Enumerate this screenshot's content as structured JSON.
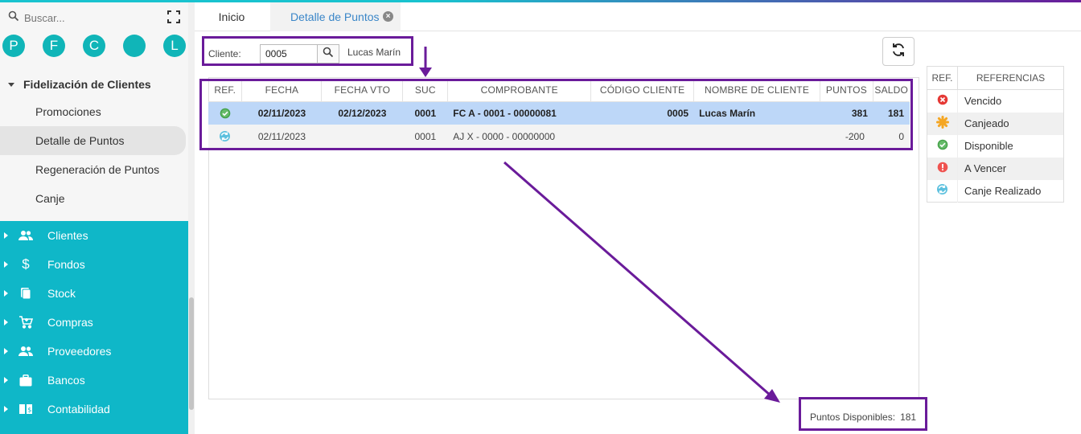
{
  "sidebar": {
    "search_placeholder": "Buscar...",
    "avatars": [
      "P",
      "F",
      "C",
      "",
      "L"
    ],
    "group_title": "Fidelización de Clientes",
    "group_items": [
      {
        "label": "Promociones"
      },
      {
        "label": "Detalle de Puntos"
      },
      {
        "label": "Regeneración de Puntos"
      },
      {
        "label": "Canje"
      }
    ],
    "modules": [
      {
        "label": "Clientes",
        "icon": "people-icon"
      },
      {
        "label": "Fondos",
        "icon": "dollar-icon"
      },
      {
        "label": "Stock",
        "icon": "box-icon"
      },
      {
        "label": "Compras",
        "icon": "cart-icon"
      },
      {
        "label": "Proveedores",
        "icon": "people-icon"
      },
      {
        "label": "Bancos",
        "icon": "briefcase-icon"
      },
      {
        "label": "Contabilidad",
        "icon": "ledger-icon"
      }
    ]
  },
  "tabs": {
    "inicio": "Inicio",
    "detalle": "Detalle de Puntos"
  },
  "client": {
    "label": "Cliente:",
    "code": "0005",
    "name": "Lucas Marín"
  },
  "grid": {
    "headers": [
      "REF.",
      "FECHA",
      "FECHA VTO",
      "SUC",
      "COMPROBANTE",
      "CÓDIGO CLIENTE",
      "NOMBRE DE CLIENTE",
      "PUNTOS",
      "SALDO"
    ],
    "rows": [
      {
        "ref": "disponible-icon",
        "fecha": "02/11/2023",
        "vto": "02/12/2023",
        "suc": "0001",
        "comprobante": "FC A - 0001 - 00000081",
        "codigo": "0005",
        "nombre": "Lucas Marín",
        "puntos": "381",
        "saldo": "181"
      },
      {
        "ref": "canje-realizado-icon",
        "fecha": "02/11/2023",
        "vto": "",
        "suc": "0001",
        "comprobante": "AJ X - 0000 - 00000000",
        "codigo": "",
        "nombre": "",
        "puntos": "-200",
        "saldo": "0"
      }
    ]
  },
  "legend": {
    "header_ref": "REF.",
    "header_title": "REFERENCIAS",
    "items": [
      {
        "label": "Vencido",
        "icon": "vencido-icon",
        "color": "#e53935"
      },
      {
        "label": "Canjeado",
        "icon": "canjeado-icon",
        "color": "#f5a623"
      },
      {
        "label": "Disponible",
        "icon": "disponible-icon",
        "color": "#43a047"
      },
      {
        "label": "A Vencer",
        "icon": "a-vencer-icon",
        "color": "#e53935"
      },
      {
        "label": "Canje Realizado",
        "icon": "canje-realizado-icon",
        "color": "#2a9fd6"
      }
    ]
  },
  "footer": {
    "label": "Puntos Disponibles:",
    "value": "181"
  },
  "colors": {
    "accent_teal": "#0fb7c8",
    "highlight_purple": "#6a1b9a",
    "selected_row": "#bdd7f8"
  }
}
